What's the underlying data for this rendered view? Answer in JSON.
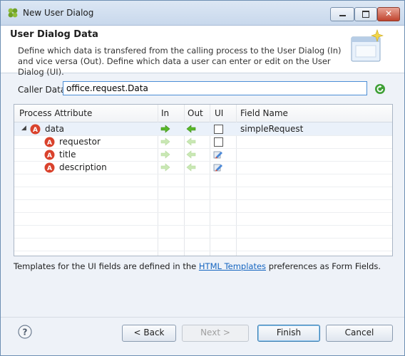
{
  "window": {
    "title": "New User Dialog"
  },
  "header": {
    "title": "User Dialog Data",
    "description": "Define which data is transfered from the calling process to the User Dialog (In) and vice versa (Out). Define which data a user can enter or edit on the User Dialog (UI)."
  },
  "caller": {
    "label": "Caller Data:",
    "value": "office.request.Data"
  },
  "table": {
    "columns": [
      "Process Attribute",
      "In",
      "Out",
      "UI",
      "Field Name"
    ],
    "rows": [
      {
        "name": "data",
        "field_name": "simpleRequest"
      },
      {
        "name": "requestor",
        "field_name": ""
      },
      {
        "name": "title",
        "field_name": ""
      },
      {
        "name": "description",
        "field_name": ""
      }
    ]
  },
  "footer": {
    "note_prefix": "Templates for the UI fields are defined in the",
    "link": "HTML Templates",
    "note_suffix": "preferences as Form Fields."
  },
  "buttons": {
    "back": "< Back",
    "next": "Next >",
    "finish": "Finish",
    "cancel": "Cancel"
  },
  "colors": {
    "accent": "#4c8ed6",
    "link": "#1565c0",
    "arrow_in": "#58b82a",
    "arrow_out": "#58b82a",
    "attr_icon": "#d9422c"
  },
  "icons": {
    "attribute": "attribute-icon",
    "in": "arrow-right-icon",
    "out": "arrow-left-icon",
    "ui": "edit-icon",
    "refresh": "refresh-icon",
    "help": "help-icon"
  }
}
